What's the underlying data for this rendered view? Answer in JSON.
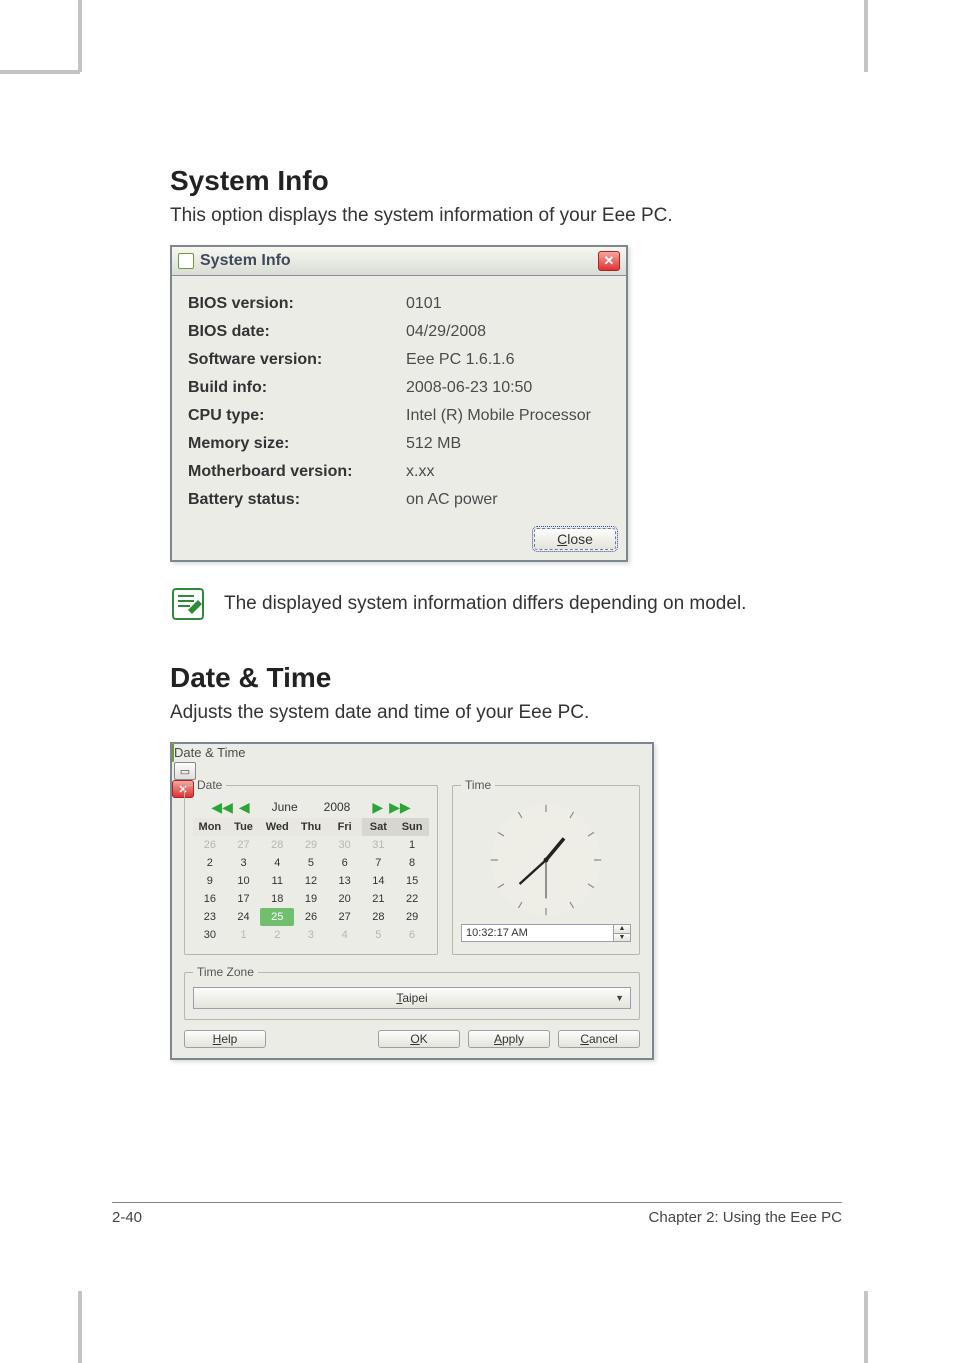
{
  "headings": {
    "system_info": "System Info",
    "system_info_desc": "This option displays the system information of your Eee PC.",
    "date_time": "Date & Time",
    "date_time_desc": "Adjusts the system date and time of your Eee PC."
  },
  "sysinfo_dialog": {
    "title": "System Info",
    "rows": [
      {
        "k": "BIOS version:",
        "v": "0101"
      },
      {
        "k": "BIOS date:",
        "v": "04/29/2008"
      },
      {
        "k": "Software version:",
        "v": "Eee PC 1.6.1.6"
      },
      {
        "k": "Build info:",
        "v": "2008-06-23 10:50"
      },
      {
        "k": "CPU type:",
        "v": "Intel (R) Mobile Processor"
      },
      {
        "k": "Memory size:",
        "v": "512 MB"
      },
      {
        "k": "Motherboard version:",
        "v": "x.xx"
      },
      {
        "k": "Battery status:",
        "v": "on AC power"
      }
    ],
    "close_label": "Close"
  },
  "note_text": "The displayed system information differs depending on model.",
  "datetime_dialog": {
    "title": "Date & Time",
    "date_legend": "Date",
    "time_legend": "Time",
    "tz_legend": "Time Zone",
    "month": "June",
    "year": "2008",
    "weekdays": [
      "Mon",
      "Tue",
      "Wed",
      "Thu",
      "Fri",
      "Sat",
      "Sun"
    ],
    "calendar": [
      [
        {
          "d": "26",
          "off": true
        },
        {
          "d": "27",
          "off": true
        },
        {
          "d": "28",
          "off": true
        },
        {
          "d": "29",
          "off": true
        },
        {
          "d": "30",
          "off": true
        },
        {
          "d": "31",
          "off": true
        },
        {
          "d": "1"
        }
      ],
      [
        {
          "d": "2"
        },
        {
          "d": "3"
        },
        {
          "d": "4"
        },
        {
          "d": "5"
        },
        {
          "d": "6"
        },
        {
          "d": "7"
        },
        {
          "d": "8"
        }
      ],
      [
        {
          "d": "9"
        },
        {
          "d": "10"
        },
        {
          "d": "11"
        },
        {
          "d": "12"
        },
        {
          "d": "13"
        },
        {
          "d": "14"
        },
        {
          "d": "15"
        }
      ],
      [
        {
          "d": "16"
        },
        {
          "d": "17"
        },
        {
          "d": "18"
        },
        {
          "d": "19"
        },
        {
          "d": "20"
        },
        {
          "d": "21"
        },
        {
          "d": "22"
        }
      ],
      [
        {
          "d": "23"
        },
        {
          "d": "24"
        },
        {
          "d": "25",
          "sel": true
        },
        {
          "d": "26"
        },
        {
          "d": "27"
        },
        {
          "d": "28"
        },
        {
          "d": "29"
        }
      ],
      [
        {
          "d": "30"
        },
        {
          "d": "1",
          "off": true
        },
        {
          "d": "2",
          "off": true
        },
        {
          "d": "3",
          "off": true
        },
        {
          "d": "4",
          "off": true
        },
        {
          "d": "5",
          "off": true
        },
        {
          "d": "6",
          "off": true
        }
      ]
    ],
    "time_value": "10:32:17 AM",
    "timezone": "Taipei",
    "help_label": "Help",
    "ok_label": "OK",
    "apply_label": "Apply",
    "cancel_label": "Cancel"
  },
  "footer": {
    "left": "2-40",
    "right": "Chapter 2: Using the Eee PC"
  }
}
